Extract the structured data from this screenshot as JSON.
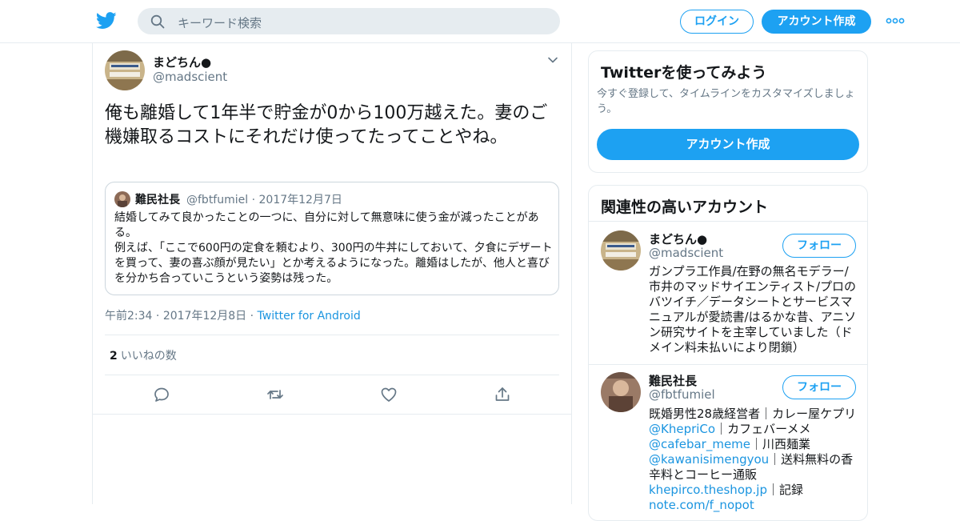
{
  "nav": {
    "search_placeholder": "キーワード検索",
    "login": "ログイン",
    "signup": "アカウント作成"
  },
  "tweet": {
    "name": "まどちん●",
    "handle": "@madscient",
    "text": "俺も離婚して1年半で貯金が0から100万越えた。妻のご機嫌取るコストにそれだけ使ってたってことやね。",
    "quote": {
      "name": "難民社長",
      "handle": "@fbtfumiel",
      "date": "2017年12月7日",
      "text": "結婚してみて良かったことの一つに、自分に対して無意味に使う金が減ったことがある。\n例えば、「ここで600円の定食を頼むより、300円の牛丼にしておいて、夕食にデザートを買って、妻の喜ぶ顔が見たい」とか考えるようになった。離婚はしたが、他人と喜びを分かち合っていこうという姿勢は残った。"
    },
    "time": "午前2:34",
    "date": "2017年12月8日",
    "source": "Twitter for Android",
    "likes_count": "2",
    "likes_label": "いいねの数"
  },
  "signup_card": {
    "title": "Twitterを使ってみよう",
    "subtitle": "今すぐ登録して、タイムラインをカスタマイズしましょう。",
    "button": "アカウント作成"
  },
  "related": {
    "title": "関連性の高いアカウント",
    "follow_label": "フォロー",
    "accounts": [
      {
        "name": "まどちん●",
        "handle": "@madscient",
        "bio": "ガンプラ工作員/在野の無名モデラー/市井のマッドサイエンティスト/プロのバツイチ／データシートとサービスマニュアルが愛読書/はるかな昔、アニソン研究サイトを主宰していました（ドメイン料未払いにより閉鎖）"
      },
      {
        "name": "難民社長",
        "handle": "@fbtfumiel",
        "bio_1": "既婚男性28歳経営者｜カレー屋ケプリ",
        "link_1": "@KhepriCo",
        "bio_2": "｜カフェバーメメ",
        "link_2": "@cafebar_meme",
        "bio_3": "｜川西麺業",
        "link_3": "@kawanisimengyou",
        "bio_4": "｜送料無料の香辛料とコーヒー通販",
        "link_4": "khepirco.theshop.jp",
        "bio_5": "｜記録",
        "link_5": "note.com/f_nopot"
      }
    ]
  }
}
